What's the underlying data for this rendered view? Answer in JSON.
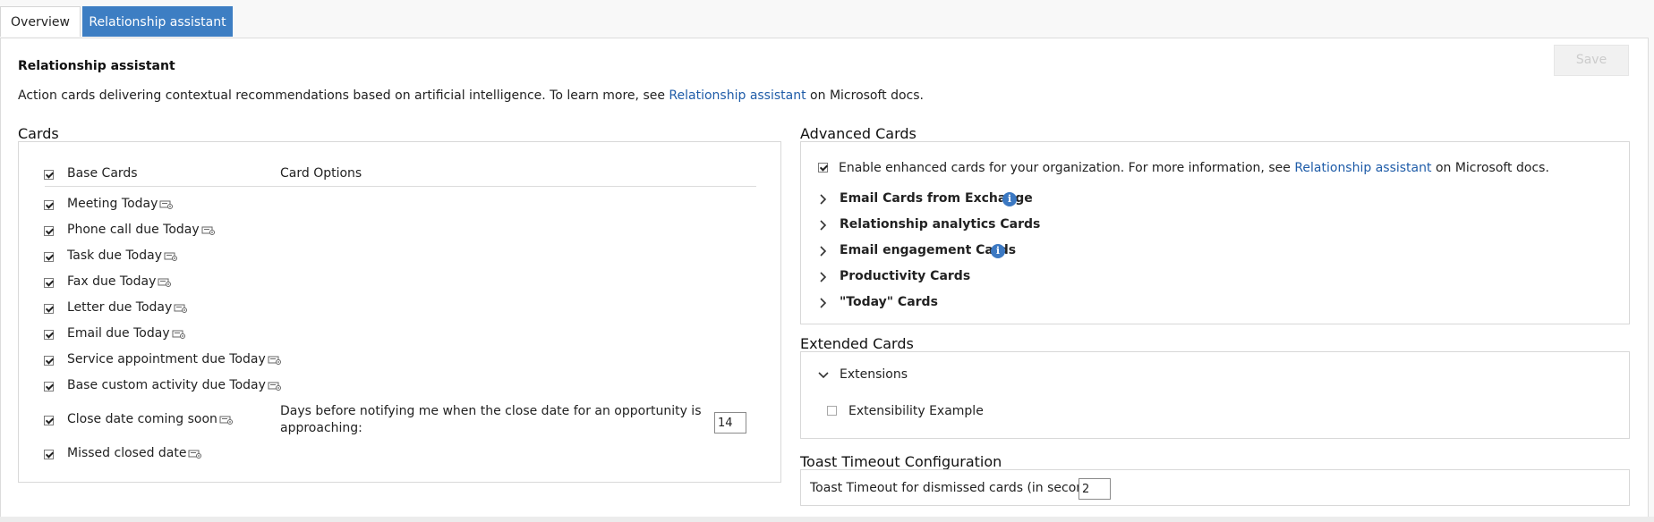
{
  "tabs": [
    {
      "label": "Overview"
    },
    {
      "label": "Relationship assistant"
    }
  ],
  "toolbar": {
    "save_label": "Save"
  },
  "page": {
    "title": "Relationship assistant",
    "desc_before": "Action cards delivering contextual recommendations based on artificial intelligence. To learn more, see ",
    "desc_link": "Relationship assistant",
    "desc_after": " on Microsoft docs."
  },
  "cards": {
    "title": "Cards",
    "col_base": "Base Cards",
    "col_options": "Card Options",
    "items": [
      {
        "label": "Meeting Today"
      },
      {
        "label": "Phone call due Today"
      },
      {
        "label": "Task due Today"
      },
      {
        "label": "Fax due Today"
      },
      {
        "label": "Letter due Today"
      },
      {
        "label": "Email due Today"
      },
      {
        "label": "Service appointment due Today"
      },
      {
        "label": "Base custom activity due Today"
      },
      {
        "label": "Close date coming soon"
      },
      {
        "label": "Missed closed date"
      }
    ],
    "close_option_text_line1": "Days before notifying me when the close date for an opportunity is",
    "close_option_text_line2": "approaching:",
    "close_option_value": "14"
  },
  "advanced": {
    "title": "Advanced Cards",
    "enable_before": "Enable enhanced cards for your organization. For more information, see ",
    "enable_link": "Relationship assistant",
    "enable_after": " on Microsoft docs.",
    "groups": [
      {
        "label": "Email Cards from Exchange"
      },
      {
        "label": "Relationship analytics Cards"
      },
      {
        "label": "Email engagement Cards"
      },
      {
        "label": "Productivity Cards"
      },
      {
        "label": "\"Today\" Cards"
      }
    ],
    "info_glyph": "i"
  },
  "extended": {
    "title": "Extended Cards",
    "group": "Extensions",
    "item": "Extensibility Example"
  },
  "toast": {
    "title": "Toast Timeout Configuration",
    "label": "Toast Timeout for dismissed cards (in seconds):",
    "value": "2"
  }
}
